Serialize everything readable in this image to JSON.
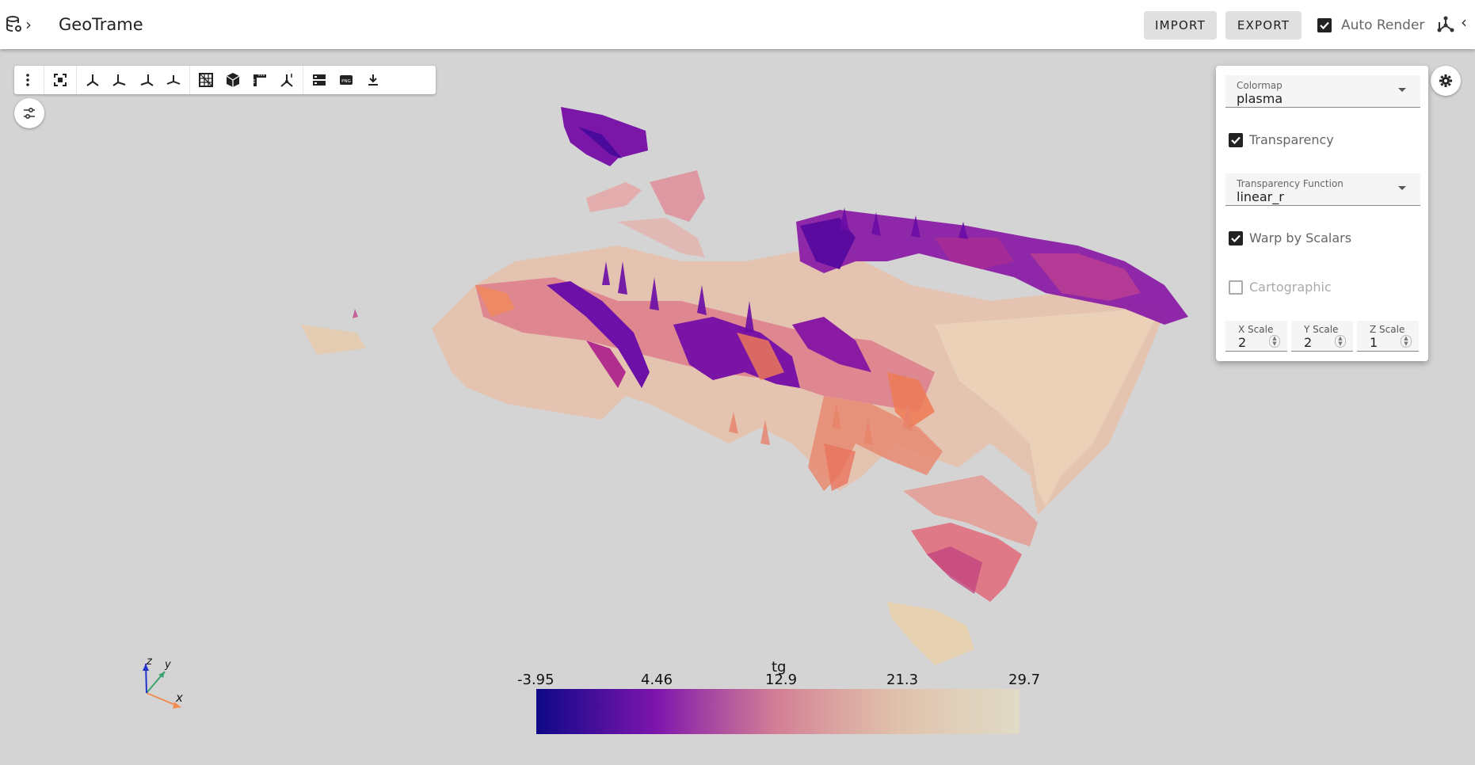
{
  "app": {
    "title": "GeoTrame",
    "buttons": {
      "import": "IMPORT",
      "export": "EXPORT"
    },
    "auto_render": {
      "label": "Auto Render",
      "checked": true
    }
  },
  "toolbar": {
    "icons": [
      "more-vert-icon",
      "fullscreen-icon",
      "axes-view-1-icon",
      "axes-view-2-icon",
      "axes-view-3-icon",
      "axes-view-4-icon",
      "grid-toggle-icon",
      "cube-box-icon",
      "ruler-icon",
      "axes-orientation-icon",
      "layers-icon",
      "png-export-icon",
      "download-icon"
    ]
  },
  "settings": {
    "colormap": {
      "label": "Colormap",
      "value": "plasma"
    },
    "transparency": {
      "label": "Transparency",
      "checked": true
    },
    "transparency_function": {
      "label": "Transparency Function",
      "value": "linear_r"
    },
    "warp": {
      "label": "Warp by Scalars",
      "checked": true
    },
    "cartographic": {
      "label": "Cartographic",
      "checked": false,
      "disabled": true
    },
    "x_scale": {
      "label": "X Scale",
      "value": "2"
    },
    "y_scale": {
      "label": "Y Scale",
      "value": "2"
    },
    "z_scale": {
      "label": "Z Scale",
      "value": "1"
    }
  },
  "scalar_bar": {
    "title": "tg",
    "ticks": [
      "-3.95",
      "4.46",
      "12.9",
      "21.3",
      "29.7"
    ],
    "colormap": "plasma"
  },
  "orientation_axes": {
    "x": "x",
    "y": "y",
    "z": "z"
  }
}
